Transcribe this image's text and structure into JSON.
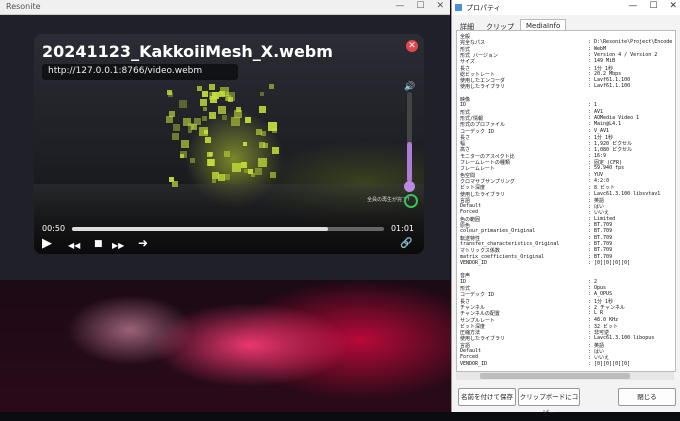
{
  "main_window": {
    "title": "Resonite",
    "controls": [
      "—",
      "☐",
      "✕"
    ]
  },
  "player": {
    "video_title": "20241123_KakkoiiMesh_X.webm",
    "url": "http://127.0.0.1:8766/video.webm",
    "current_time": "00:50",
    "total_time": "01:01",
    "progress_fraction": 0.82,
    "volume_fraction": 0.45,
    "auto_label": "全員の再生が完了？",
    "close_symbol": "✕",
    "volume_symbol": "🔊",
    "play_symbol": "▶",
    "rewind_symbol": "◀◀",
    "stop_symbol": "■",
    "forward_symbol": "▶▶",
    "next_symbol": "➜",
    "link_symbol": "🔗",
    "accent_color": "#b07cd8",
    "close_color": "#e0474c"
  },
  "properties_window": {
    "title": "プロパティ",
    "controls": [
      "—",
      "☐",
      "✕"
    ],
    "tabs": [
      "詳細",
      "クリップ",
      "MediaInfo"
    ],
    "active_tab": "MediaInfo",
    "buttons": {
      "save": "名前を付けて保存",
      "copy": "クリップボードにコピー",
      "close": "閉じる"
    },
    "mediainfo": [
      {
        "k": "全般",
        "v": ""
      },
      {
        "k": "完全なパス",
        "v": ": D:\\Resonite\\Project\\Encode"
      },
      {
        "k": "形式",
        "v": ": WebM"
      },
      {
        "k": "形式 バージョン",
        "v": ": Version 4 / Version 2"
      },
      {
        "k": "サイズ",
        "v": ": 149 MiB"
      },
      {
        "k": "長さ",
        "v": ": 1分 1秒"
      },
      {
        "k": "総ビットレート",
        "v": ": 20.2 Mbps"
      },
      {
        "k": "使用したエンコーダ",
        "v": ": Lavf61.1.100"
      },
      {
        "k": "使用したライブラリ",
        "v": ": Lavf61.1.100"
      },
      {
        "k": "",
        "v": ""
      },
      {
        "k": "映像",
        "v": ""
      },
      {
        "k": "ID",
        "v": ": 1"
      },
      {
        "k": "形式",
        "v": ": AV1"
      },
      {
        "k": "形式/情報",
        "v": ": AOMedia Video 1"
      },
      {
        "k": "形式のプロファイル",
        "v": ": Main@L4.1"
      },
      {
        "k": "コーデック ID",
        "v": ": V_AV1"
      },
      {
        "k": "長さ",
        "v": ": 1分 1秒"
      },
      {
        "k": "幅",
        "v": ": 1,920 ピクセル"
      },
      {
        "k": "高さ",
        "v": ": 1,080 ピクセル"
      },
      {
        "k": "モニターのアスペクト比",
        "v": ": 16:9"
      },
      {
        "k": "フレームレートの種類",
        "v": ": 固定 (CFR)"
      },
      {
        "k": "フレームレート",
        "v": ": 59.940 fps"
      },
      {
        "k": "色空間",
        "v": ": YUV"
      },
      {
        "k": "クロマサブサンプリング",
        "v": ": 4:2:0"
      },
      {
        "k": "ビット深度",
        "v": ": 8 ビット"
      },
      {
        "k": "使用したライブラリ",
        "v": ": Lavc61.3.100 libsvtav1"
      },
      {
        "k": "言語",
        "v": ": 英語"
      },
      {
        "k": "Default",
        "v": ": はい"
      },
      {
        "k": "Forced",
        "v": ": いいえ"
      },
      {
        "k": "色の範囲",
        "v": ": Limited"
      },
      {
        "k": "原色",
        "v": ": BT.709"
      },
      {
        "k": "colour_primaries_Original",
        "v": ": BT.709"
      },
      {
        "k": "転送特性",
        "v": ": BT.709"
      },
      {
        "k": "transfer_characteristics_Original",
        "v": ": BT.709"
      },
      {
        "k": "マトリックス係数",
        "v": ": BT.709"
      },
      {
        "k": "matrix_coefficients_Original",
        "v": ": BT.709"
      },
      {
        "k": "VENDOR_ID",
        "v": ": [0][0][0][0]"
      },
      {
        "k": "",
        "v": ""
      },
      {
        "k": "音声",
        "v": ""
      },
      {
        "k": "ID",
        "v": ": 2"
      },
      {
        "k": "形式",
        "v": ": Opus"
      },
      {
        "k": "コーデック ID",
        "v": ": A_OPUS"
      },
      {
        "k": "長さ",
        "v": ": 1分 1秒"
      },
      {
        "k": "チャンネル",
        "v": ": 2 チャンネル"
      },
      {
        "k": "チャンネルの配置",
        "v": ": L R"
      },
      {
        "k": "サンプルレート",
        "v": ": 48.0 KHz"
      },
      {
        "k": "ビット深度",
        "v": ": 32 ビット"
      },
      {
        "k": "圧縮方法",
        "v": ": 非可逆"
      },
      {
        "k": "使用したライブラリ",
        "v": ": Lavc61.3.100 libopus"
      },
      {
        "k": "言語",
        "v": ": 英語"
      },
      {
        "k": "Default",
        "v": ": はい"
      },
      {
        "k": "Forced",
        "v": ": いいえ"
      },
      {
        "k": "VENDOR_ID",
        "v": ": [0][0][0][0]"
      }
    ]
  }
}
